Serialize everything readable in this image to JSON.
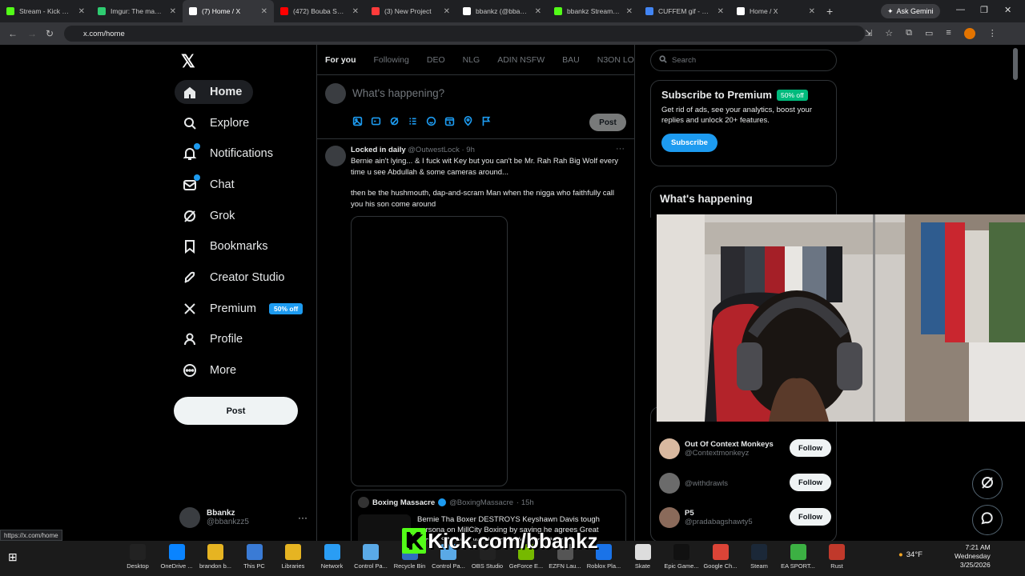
{
  "browser": {
    "tabs": [
      {
        "title": "Stream - Kick Dash",
        "color": "#53fc18"
      },
      {
        "title": "Imgur: The magic o",
        "color": "#2ecc71"
      },
      {
        "title": "(7) Home / X",
        "color": "#ffffff",
        "active": true
      },
      {
        "title": "(472) Bouba Savag",
        "color": "#ff0000"
      },
      {
        "title": "(3) New Project",
        "color": "#ff3b3b"
      },
      {
        "title": "bbankz (@bbankz",
        "color": "#ffffff"
      },
      {
        "title": "bbankz Stream - W",
        "color": "#53fc18"
      },
      {
        "title": "CUFFEM gif - Sear",
        "color": "#4285f4"
      },
      {
        "title": "Home / X",
        "color": "#ffffff"
      }
    ],
    "ask_gemini": "Ask Gemini",
    "url": "x.com/home",
    "status_url": "https://x.com/home"
  },
  "sidebar": {
    "logo": "𝕏",
    "items": [
      {
        "label": "Home",
        "icon": "home-icon"
      },
      {
        "label": "Explore",
        "icon": "search-icon"
      },
      {
        "label": "Notifications",
        "icon": "bell-icon"
      },
      {
        "label": "Chat",
        "icon": "mail-icon"
      },
      {
        "label": "Grok",
        "icon": "grok-icon"
      },
      {
        "label": "Bookmarks",
        "icon": "bookmark-icon"
      },
      {
        "label": "Creator Studio",
        "icon": "rocket-icon"
      },
      {
        "label": "Premium",
        "icon": "x-icon",
        "pill": "50% off"
      },
      {
        "label": "Profile",
        "icon": "person-icon"
      },
      {
        "label": "More",
        "icon": "more-icon"
      }
    ],
    "post_label": "Post",
    "account": {
      "name": "Bbankz",
      "handle": "@bbankzz5"
    }
  },
  "main": {
    "tabs": [
      "For you",
      "Following",
      "DEO",
      "NLG",
      "ADIN NSFW",
      "BAU",
      "N3ON LOYAL"
    ],
    "composer_placeholder": "What's happening?",
    "composer_post": "Post",
    "tweet": {
      "name": "Locked in daily",
      "handle": "@OutwestLock",
      "time": "· 9h",
      "text1": "Bernie ain't lying... & I fuck wit Key but you can't be Mr. Rah Rah Big Wolf every time u see Abdullah & some cameras around...",
      "text2": "then be the hushmouth, dap-and-scram Man when the nigga who faithfully call you his son come around",
      "quote": {
        "name": "Boxing Massacre",
        "handle": "@BoxingMassacre",
        "time": "· 15h",
        "text": "Bernie Tha Boxer DESTROYS Keyshawn Davis tough persona on MillCity Boxing by saying he agrees Great Jackal SAVAGE words on his former fighter"
      }
    }
  },
  "right": {
    "search_placeholder": "Search",
    "premium": {
      "title": "Subscribe to Premium",
      "pill": "50% off",
      "text": "Get rid of ads, see your analytics, boost your replies and unlock 20+ features.",
      "button": "Subscribe"
    },
    "happening_title": "What's happening",
    "follow": [
      {
        "name": "Out Of Context Monkeys",
        "handle": "@Contextmonkeyz",
        "color": "#d9b9a0"
      },
      {
        "name": "",
        "handle": "@withdrawls",
        "color": "#6b6b6b"
      },
      {
        "name": "P5",
        "handle": "@pradabagshawty5",
        "color": "#8a6a5a"
      }
    ],
    "follow_label": "Follow"
  },
  "overlay": {
    "kick_text": "Kick.com/bbankz",
    "kick_k": "K"
  },
  "taskbar": {
    "items": [
      "Desktop",
      "OneDrive ...",
      "brandon b...",
      "This PC",
      "Libraries",
      "Network",
      "Control Pa...",
      "Recycle Bin",
      "Control Pa...",
      "OBS Studio",
      "GeForce E...",
      "EZFN Lau...",
      "Roblox Pla...",
      "Skate",
      "Epic Game...",
      "Google Ch...",
      "Steam",
      "EA SPORT...",
      "Rust"
    ],
    "weather": "34°F",
    "time": "7:21 AM",
    "day": "Wednesday",
    "date": "3/25/2026"
  }
}
